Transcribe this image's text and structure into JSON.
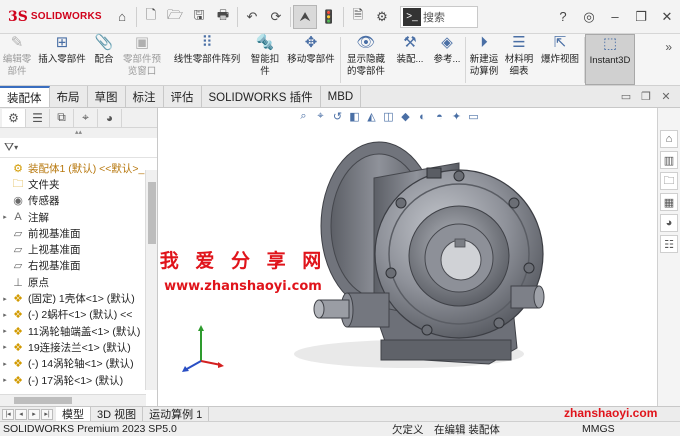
{
  "app": {
    "logo_mark": "3S",
    "logo_text": "SOLIDWORKS",
    "search_placeholder": "搜索"
  },
  "quick_access": [
    {
      "name": "home-icon",
      "glyph": "⌂"
    },
    {
      "name": "new-document-icon",
      "glyph": "🗋"
    },
    {
      "name": "open-folder-icon",
      "glyph": "🗁"
    },
    {
      "name": "save-icon",
      "glyph": "🖫"
    },
    {
      "name": "print-icon",
      "glyph": "🖶"
    },
    {
      "name": "undo-icon",
      "glyph": "↶"
    },
    {
      "name": "rebuild-icon",
      "glyph": "⟳"
    },
    {
      "name": "select-arrow-icon",
      "glyph": "⮝"
    },
    {
      "name": "traffic-light-icon",
      "glyph": "🚦"
    },
    {
      "name": "file-properties-icon",
      "glyph": "🗎"
    },
    {
      "name": "options-gear-icon",
      "glyph": "⚙"
    }
  ],
  "ribbon": [
    {
      "label": "编辑零\n部件",
      "icon": "edit-component-icon",
      "glyph": "✎",
      "disabled": true
    },
    {
      "label": "插入零部件",
      "icon": "insert-component-icon",
      "glyph": "⊞",
      "disabled": false
    },
    {
      "label": "配合",
      "icon": "mate-icon",
      "glyph": "📎",
      "disabled": false
    },
    {
      "label": "零部件预\n览窗口",
      "icon": "component-preview-icon",
      "glyph": "▣",
      "disabled": true
    },
    {
      "label": "线性零部件阵列",
      "icon": "linear-pattern-icon",
      "glyph": "⠿",
      "disabled": false
    },
    {
      "label": "智能扣\n件",
      "icon": "smart-fastener-icon",
      "glyph": "🔩",
      "disabled": false
    },
    {
      "label": "移动零部件",
      "icon": "move-component-icon",
      "glyph": "✥",
      "disabled": false
    },
    {
      "label": "显示隐藏\n的零部件",
      "icon": "show-hidden-icon",
      "glyph": "👁",
      "disabled": false
    },
    {
      "label": "装配...",
      "icon": "assembly-features-icon",
      "glyph": "⚒",
      "disabled": false
    },
    {
      "label": "参考...",
      "icon": "reference-geometry-icon",
      "glyph": "◈",
      "disabled": false
    },
    {
      "label": "新建运\n动算例",
      "icon": "new-motion-study-icon",
      "glyph": "⏵",
      "disabled": false
    },
    {
      "label": "材料明\n细表",
      "icon": "bill-of-materials-icon",
      "glyph": "☰",
      "disabled": false
    },
    {
      "label": "爆炸视图",
      "icon": "exploded-view-icon",
      "glyph": "⇱",
      "disabled": false
    },
    {
      "label": "Instant3D",
      "icon": "instant3d-icon",
      "glyph": "⬚",
      "disabled": false,
      "active": true
    }
  ],
  "tabs": [
    "装配体",
    "布局",
    "草图",
    "标注",
    "评估",
    "SOLIDWORKS 插件",
    "MBD"
  ],
  "active_tab": 0,
  "tree": [
    {
      "label": "装配体1 (默认) <<默认>_",
      "icon": "assembly-icon",
      "glyph": "⚙",
      "expander": "",
      "top": true
    },
    {
      "label": "文件夹",
      "icon": "folder-icon",
      "glyph": "🗀",
      "expander": "",
      "top": false
    },
    {
      "label": "传感器",
      "icon": "sensor-icon",
      "glyph": "◉",
      "expander": "",
      "top": false
    },
    {
      "label": "注解",
      "icon": "annotation-icon",
      "glyph": "A",
      "expander": "▸",
      "top": false
    },
    {
      "label": "前视基准面",
      "icon": "plane-icon",
      "glyph": "▱",
      "expander": "",
      "top": false
    },
    {
      "label": "上视基准面",
      "icon": "plane-icon",
      "glyph": "▱",
      "expander": "",
      "top": false
    },
    {
      "label": "右视基准面",
      "icon": "plane-icon",
      "glyph": "▱",
      "expander": "",
      "top": false
    },
    {
      "label": "原点",
      "icon": "origin-icon",
      "glyph": "⊥",
      "expander": "",
      "top": false
    },
    {
      "label": "(固定) 1壳体<1> (默认)",
      "icon": "part-icon",
      "glyph": "❖",
      "expander": "▸",
      "top": false
    },
    {
      "label": "(-) 2蜗杆<1> (默认) <<",
      "icon": "part-icon",
      "glyph": "❖",
      "expander": "▸",
      "top": false
    },
    {
      "label": "11涡轮轴端盖<1> (默认)",
      "icon": "part-icon",
      "glyph": "❖",
      "expander": "▸",
      "top": false
    },
    {
      "label": "19连接法兰<1> (默认)",
      "icon": "part-icon",
      "glyph": "❖",
      "expander": "▸",
      "top": false
    },
    {
      "label": "(-) 14涡轮轴<1> (默认)",
      "icon": "part-icon",
      "glyph": "❖",
      "expander": "▸",
      "top": false
    },
    {
      "label": "(-) 17涡轮<1> (默认)",
      "icon": "part-icon",
      "glyph": "❖",
      "expander": "▸",
      "top": false
    }
  ],
  "viewport": {
    "watermark_cn": "我 爱 分 享 网",
    "watermark_url": "www.zhanshaoyi.com"
  },
  "bottom_tabs": [
    "模型",
    "3D 视图",
    "运动算例 1"
  ],
  "active_bottom_tab": 0,
  "status": {
    "product": "SOLIDWORKS Premium 2023 SP5.0",
    "defined": "欠定义",
    "editing": "在编辑 装配体",
    "units": "MMGS",
    "watermark": "zhanshaoyi.com"
  },
  "colors": {
    "brand": "#d0021b",
    "watermark": "#e0141b",
    "model_body": "#8a8d96"
  }
}
